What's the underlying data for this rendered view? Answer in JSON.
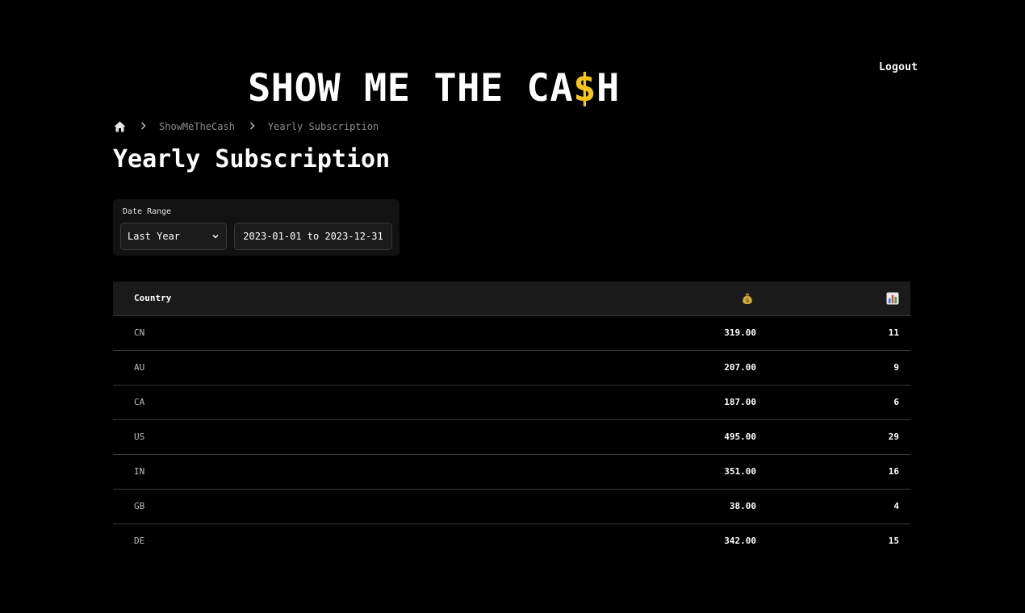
{
  "header": {
    "brand_prefix": "SHOW ME THE CA",
    "brand_dollar": "$",
    "brand_suffix": "H",
    "logout_label": "Logout"
  },
  "breadcrumb": {
    "items": [
      "ShowMeTheCash",
      "Yearly Subscription"
    ]
  },
  "page": {
    "title": "Yearly Subscription"
  },
  "filter": {
    "label": "Date Range",
    "selected_range": "Last Year",
    "date_value": "2023-01-01 to 2023-12-31"
  },
  "table": {
    "headers": {
      "country": "Country",
      "amount_icon": "money-bag-icon",
      "count_icon": "bar-chart-icon"
    },
    "rows": [
      {
        "country": "CN",
        "amount": "319.00",
        "count": "11"
      },
      {
        "country": "AU",
        "amount": "207.00",
        "count": "9"
      },
      {
        "country": "CA",
        "amount": "187.00",
        "count": "6"
      },
      {
        "country": "US",
        "amount": "495.00",
        "count": "29"
      },
      {
        "country": "IN",
        "amount": "351.00",
        "count": "16"
      },
      {
        "country": "GB",
        "amount": "38.00",
        "count": "4"
      },
      {
        "country": "DE",
        "amount": "342.00",
        "count": "15"
      }
    ]
  },
  "colors": {
    "background": "#000000",
    "accent_dollar": "#f5c518",
    "header_row": "#1a1a1a",
    "divider": "#3a3a3a"
  }
}
